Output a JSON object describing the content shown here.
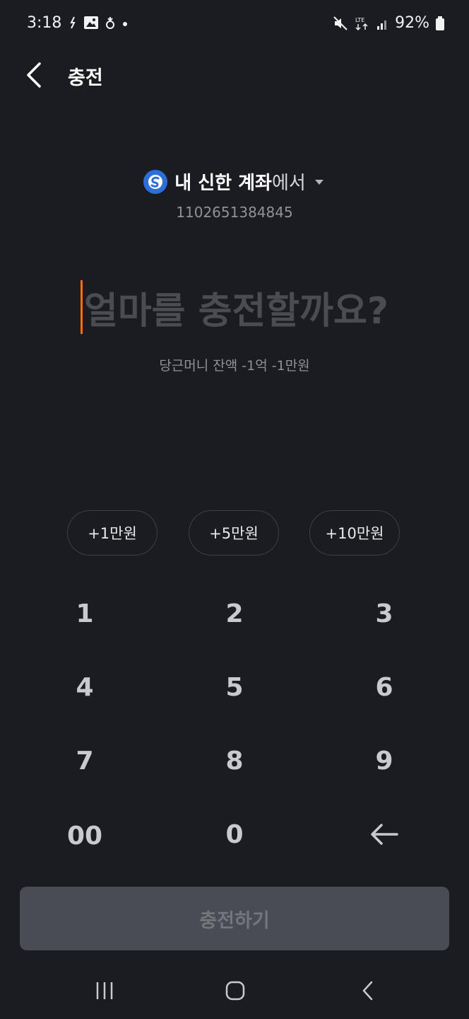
{
  "status_bar": {
    "time": "3:18",
    "battery": "92%",
    "network": "LTE"
  },
  "header": {
    "title": "충전",
    "back_icon": "chevron-left-icon"
  },
  "account": {
    "bank_icon": "shinhan-bank-icon",
    "name": "내 신한 계좌",
    "suffix": "에서",
    "number": "1102651384845"
  },
  "amount": {
    "placeholder": "얼마를 충전할까요?",
    "balance": "당근머니 잔액 -1억 -1만원"
  },
  "quick_add": [
    {
      "label": "+1만원"
    },
    {
      "label": "+5만원"
    },
    {
      "label": "+10만원"
    }
  ],
  "keypad": {
    "keys": [
      "1",
      "2",
      "3",
      "4",
      "5",
      "6",
      "7",
      "8",
      "9",
      "00",
      "0"
    ],
    "backspace_icon": "backspace-arrow-icon"
  },
  "submit": {
    "label": "충전하기"
  },
  "colors": {
    "background": "#1b1c21",
    "accent": "#ff6f0f",
    "bank_blue": "#2d6fd8",
    "disabled_button": "#4a4c53"
  }
}
